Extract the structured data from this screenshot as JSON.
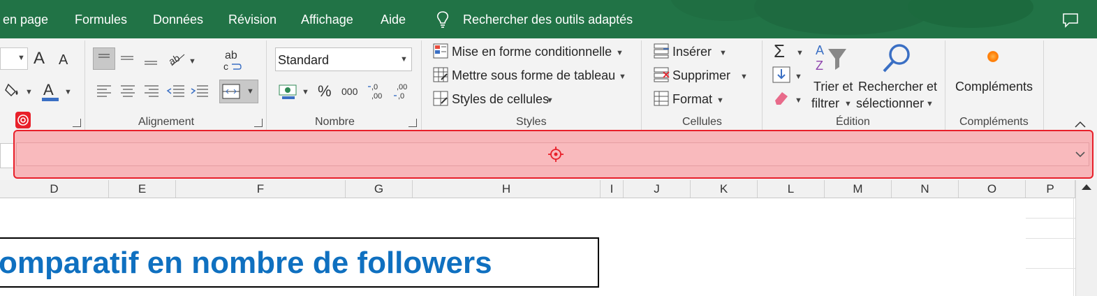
{
  "menu": {
    "items": [
      "en page",
      "Formules",
      "Données",
      "Révision",
      "Affichage",
      "Aide"
    ],
    "search_label": "Rechercher des outils adaptés"
  },
  "ribbon": {
    "font_grow": "A",
    "font_shrink": "A",
    "wrap_text": "ab",
    "number_format": "Standard",
    "percent": "%",
    "thousands": "000",
    "dec_increase": ",0\n,00",
    "dec_decrease": ",00\n,0",
    "styles": {
      "conditional": "Mise en forme conditionnelle",
      "table": "Mettre sous forme de tableau",
      "cell_styles": "Styles de cellules"
    },
    "cells": {
      "insert": "Insérer",
      "delete": "Supprimer",
      "format": "Format"
    },
    "edition": {
      "sort_line1": "Trier et",
      "sort_line2": "filtrer",
      "find_line1": "Rechercher et",
      "find_line2": "sélectionner"
    },
    "addins": "Compléments",
    "groups": {
      "alignment": "Alignement",
      "number": "Nombre",
      "styles": "Styles",
      "cells": "Cellules",
      "edition": "Édition",
      "addins": "Compléments"
    }
  },
  "columns": [
    "D",
    "E",
    "F",
    "G",
    "H",
    "I",
    "J",
    "K",
    "L",
    "M",
    "N",
    "O",
    "P"
  ],
  "sheet": {
    "title": "omparatif en nombre de followers"
  },
  "colors": {
    "menu_bg": "#217346",
    "highlight_border": "#e8202a",
    "highlight_fill": "#f7b6b9",
    "title_color": "#0f70c0"
  }
}
